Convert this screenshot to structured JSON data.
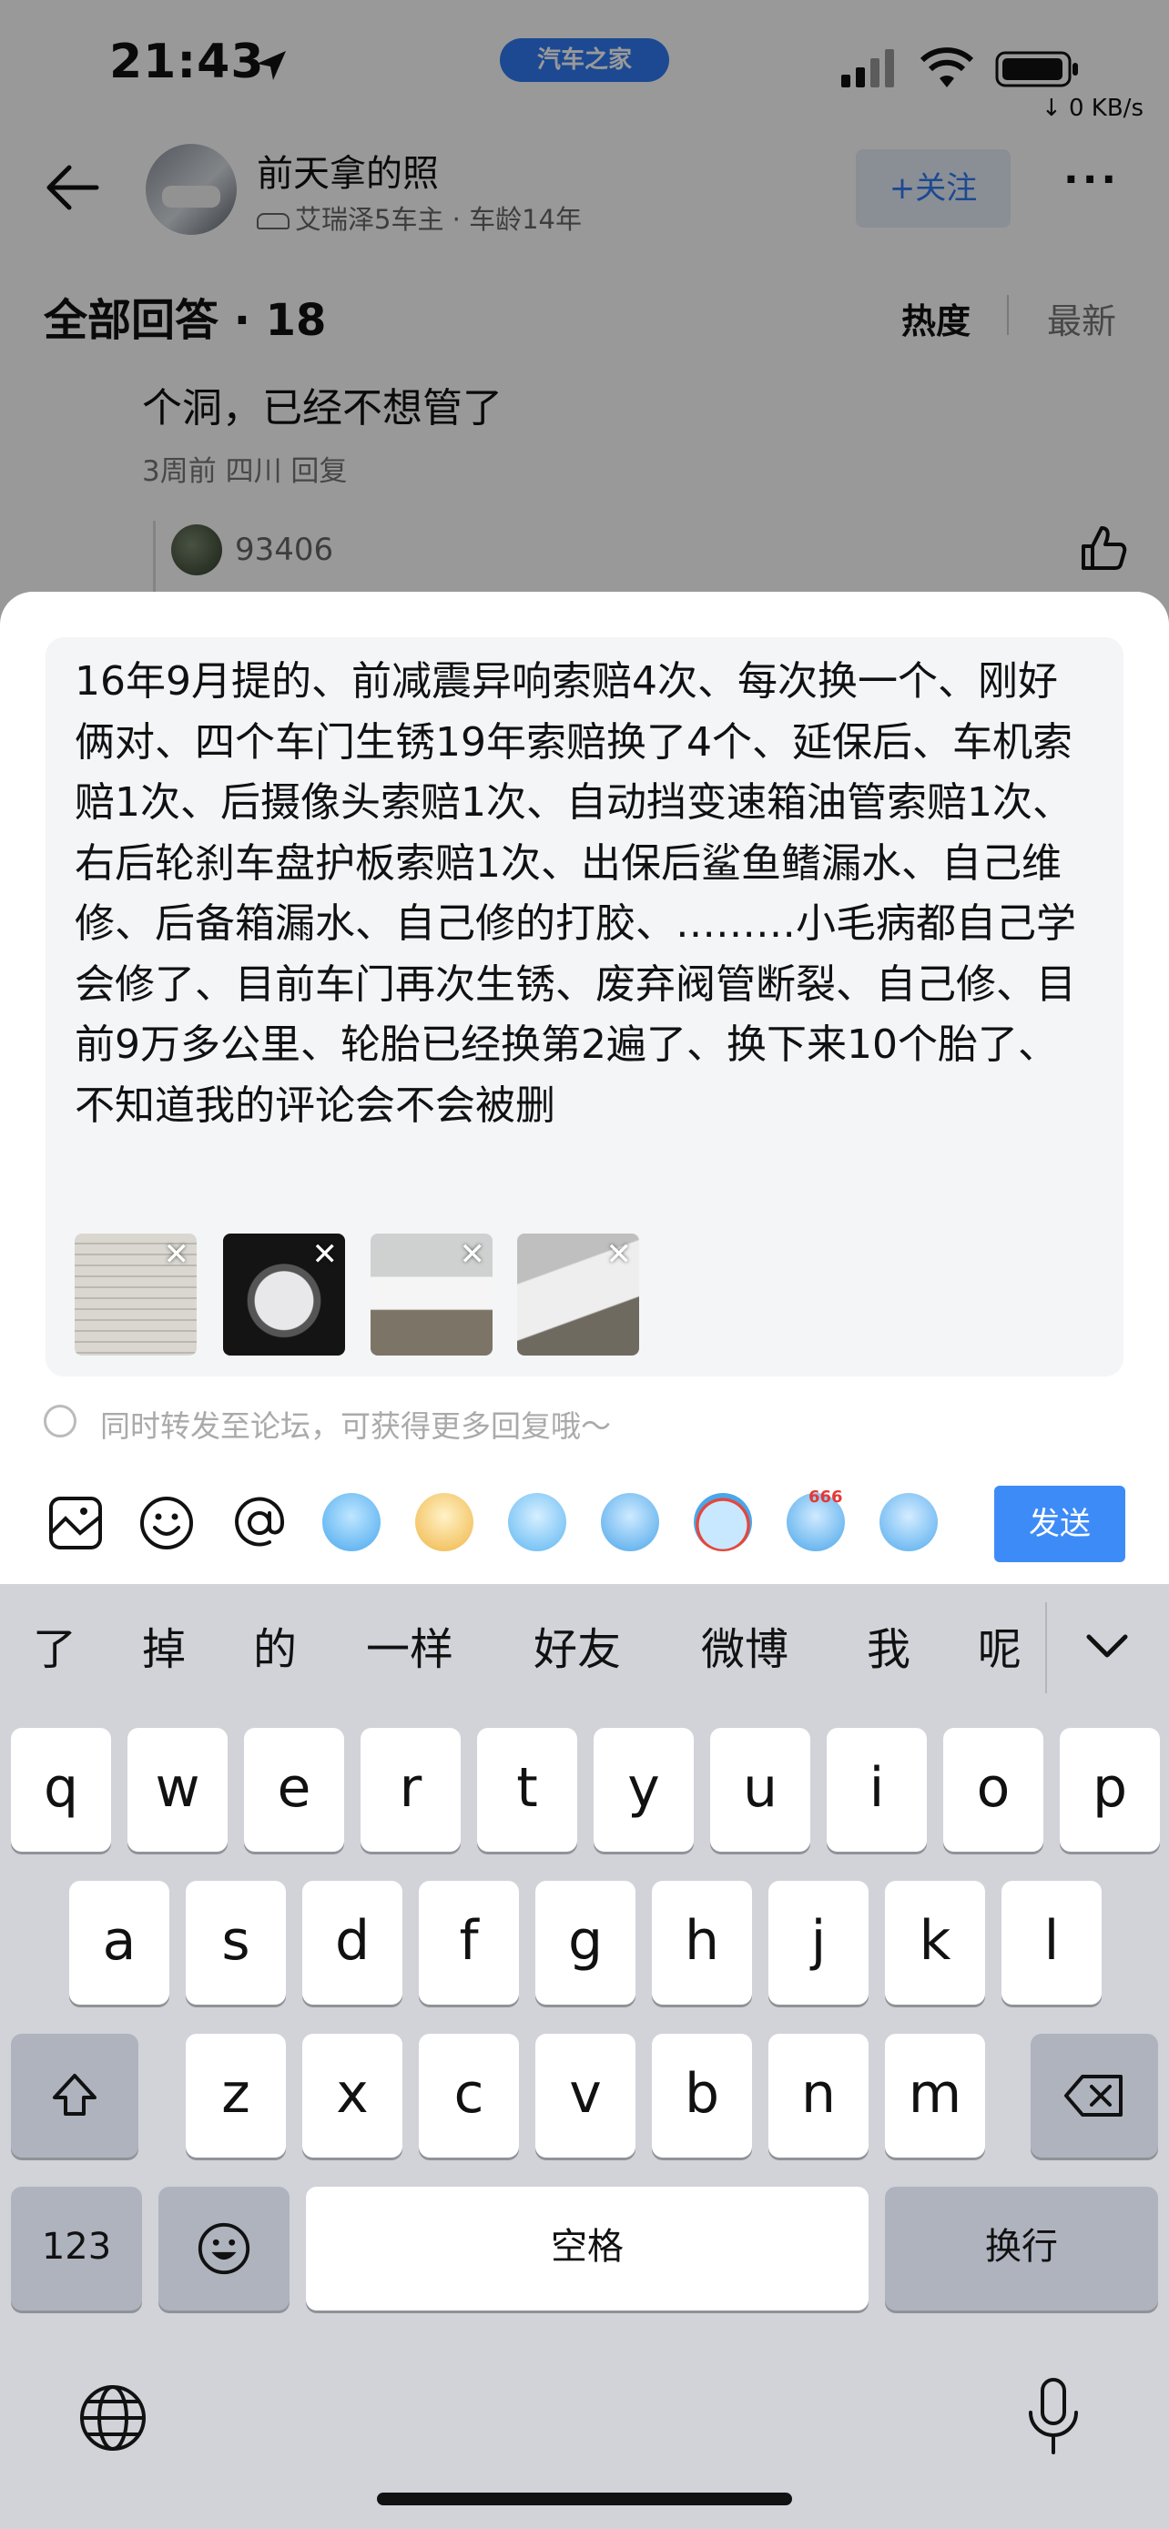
{
  "status_bar": {
    "time": "21:43",
    "app_badge": "汽车之家",
    "net_speed": "↓ 0 KB/s"
  },
  "header": {
    "title": "前天拿的照",
    "subtitle": "艾瑞泽5车主 · 车龄14年",
    "follow_label": "+关注",
    "more_label": "···"
  },
  "answers": {
    "title": "全部回答 · 18",
    "sort_hot": "热度",
    "sort_new": "最新",
    "comment_text": "个洞，已经不想管了",
    "comment_meta": "3周前 四川 回复",
    "reply_user": "93406"
  },
  "composer": {
    "text": "16年9月提的、前减震异响索赔4次、每次换一个、刚好俩对、四个车门生锈19年索赔换了4个、延保后、车机索赔1次、后摄像头索赔1次、自动挡变速箱油管索赔1次、右后轮刹车盘护板索赔1次、出保后鲨鱼鳍漏水、自己维修、后备箱漏水、自己修的打胶、………小毛病都自己学会修了、目前车门再次生锈、废弃阀管断裂、自己修、目前9万多公里、轮胎已经换第2遍了、换下来10个胎了、不知道我的评论会不会被删",
    "remove_label": "✕",
    "forward_text": "同时转发至论坛，可获得更多回复哦～",
    "send_label": "发送",
    "emoji_badge": "666"
  },
  "keyboard": {
    "candidates": [
      "了",
      "掉",
      "的",
      "一样",
      "好友",
      "微博",
      "我",
      "呢"
    ],
    "row1": [
      "q",
      "w",
      "e",
      "r",
      "t",
      "y",
      "u",
      "i",
      "o",
      "p"
    ],
    "row2": [
      "a",
      "s",
      "d",
      "f",
      "g",
      "h",
      "j",
      "k",
      "l"
    ],
    "row3": [
      "z",
      "x",
      "c",
      "v",
      "b",
      "n",
      "m"
    ],
    "num_label": "123",
    "space_label": "空格",
    "return_label": "换行"
  },
  "colors": {
    "accent": "#2f7bf4",
    "send": "#3d8bf7",
    "keyboard_bg": "#d1d3d9"
  }
}
